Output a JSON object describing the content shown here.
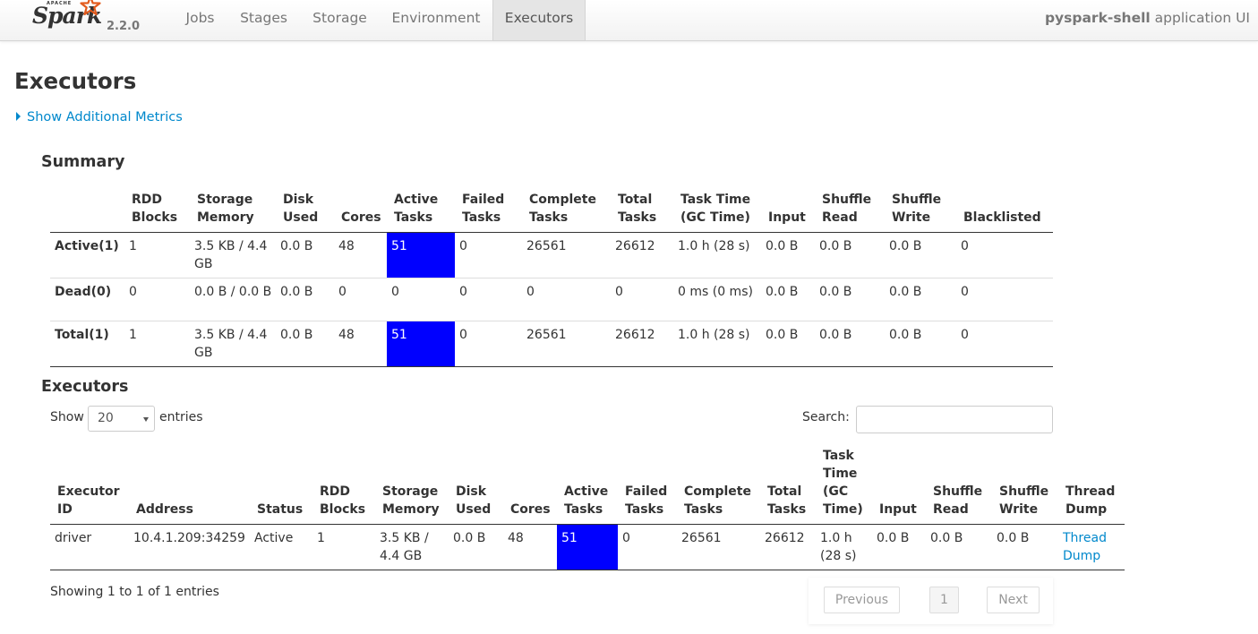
{
  "brand": {
    "apache": "APACHE",
    "name": "Spark",
    "version": "2.2.0"
  },
  "nav": {
    "tabs": [
      "Jobs",
      "Stages",
      "Storage",
      "Environment",
      "Executors"
    ],
    "active": "Executors",
    "app_name": "pyspark-shell",
    "app_suffix": " application UI"
  },
  "page": {
    "title": "Executors",
    "show_metrics": "Show Additional Metrics"
  },
  "summary": {
    "title": "Summary",
    "headers": [
      "",
      "RDD Blocks",
      "Storage Memory",
      "Disk Used",
      "Cores",
      "Active Tasks",
      "Failed Tasks",
      "Complete Tasks",
      "Total Tasks",
      "Task Time (GC Time)",
      "Input",
      "Shuffle Read",
      "Shuffle Write",
      "Blacklisted"
    ],
    "rows": [
      [
        "Active(1)",
        "1",
        "3.5 KB / 4.4 GB",
        "0.0 B",
        "48",
        "51",
        "0",
        "26561",
        "26612",
        "1.0 h (28 s)",
        "0.0 B",
        "0.0 B",
        "0.0 B",
        "0"
      ],
      [
        "Dead(0)",
        "0",
        "0.0 B / 0.0 B",
        "0.0 B",
        "0",
        "0",
        "0",
        "0",
        "0",
        "0 ms (0 ms)",
        "0.0 B",
        "0.0 B",
        "0.0 B",
        "0"
      ],
      [
        "Total(1)",
        "1",
        "3.5 KB / 4.4 GB",
        "0.0 B",
        "48",
        "51",
        "0",
        "26561",
        "26612",
        "1.0 h (28 s)",
        "0.0 B",
        "0.0 B",
        "0.0 B",
        "0"
      ]
    ]
  },
  "executors": {
    "title": "Executors",
    "show_label": "Show",
    "page_size": "20",
    "entries_label": "entries",
    "search_label": "Search:",
    "search_value": "",
    "headers": [
      "Executor ID",
      "Address",
      "Status",
      "RDD Blocks",
      "Storage Memory",
      "Disk Used",
      "Cores",
      "Active Tasks",
      "Failed Tasks",
      "Complete Tasks",
      "Total Tasks",
      "Task Time (GC Time)",
      "Input",
      "Shuffle Read",
      "Shuffle Write",
      "Thread Dump"
    ],
    "rows": [
      [
        "driver",
        "10.4.1.209:34259",
        "Active",
        "1",
        "3.5 KB / 4.4 GB",
        "0.0 B",
        "48",
        "51",
        "0",
        "26561",
        "26612",
        "1.0 h (28 s)",
        "0.0 B",
        "0.0 B",
        "0.0 B",
        "Thread Dump"
      ]
    ],
    "info": "Showing 1 to 1 of 1 entries",
    "pagination": {
      "previous": "Previous",
      "current": "1",
      "next": "Next"
    }
  },
  "colors": {
    "active_tasks_bg": "#0000ff",
    "link": "#0088cc"
  }
}
